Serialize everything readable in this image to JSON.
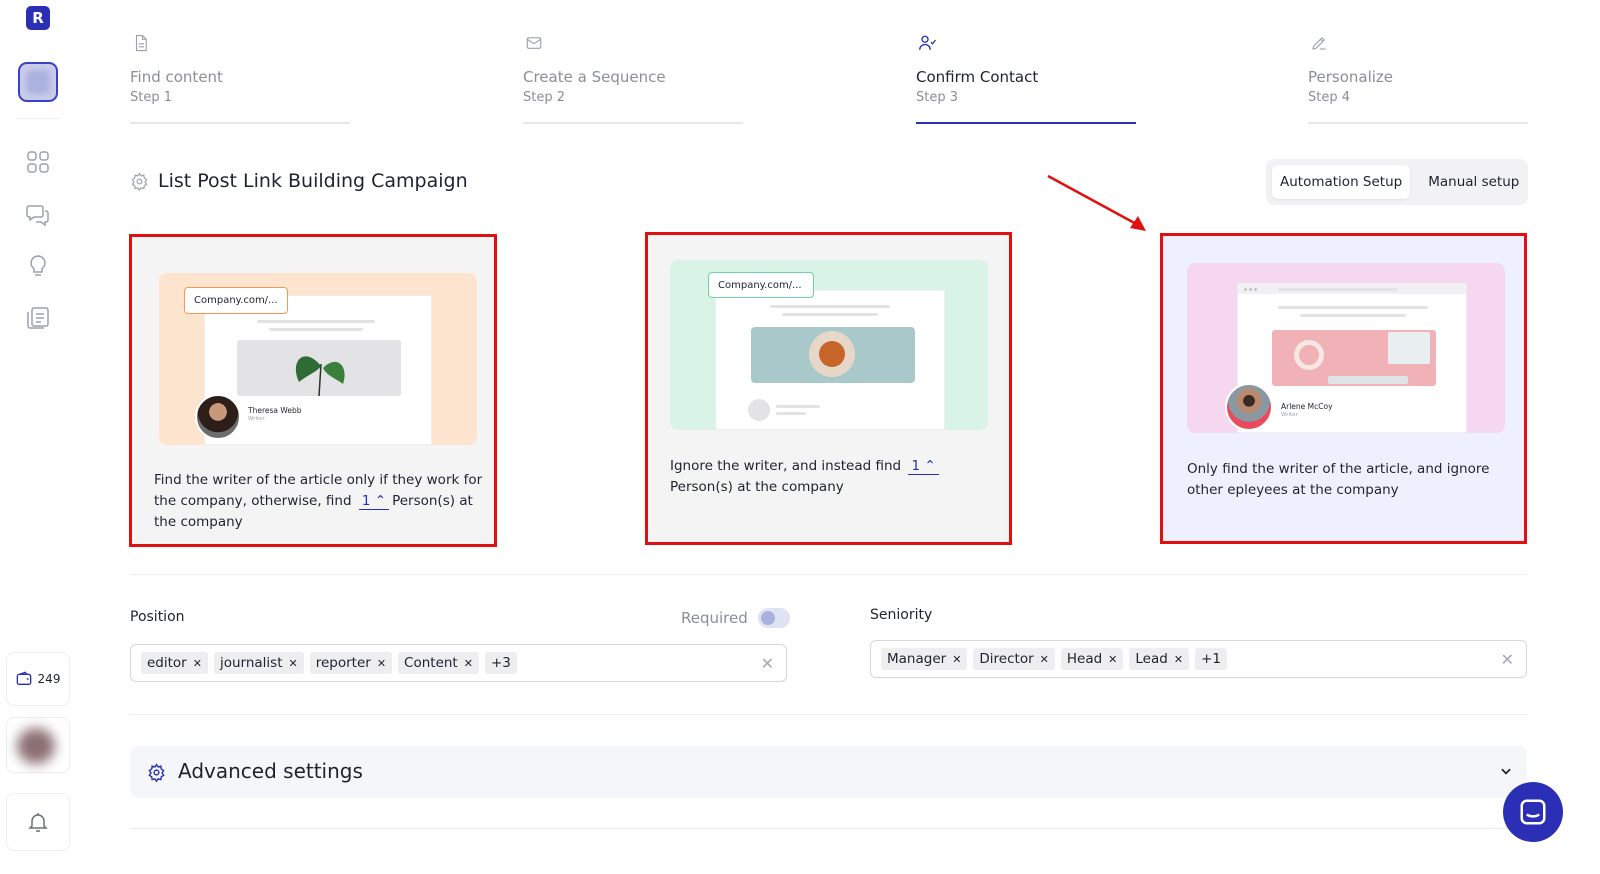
{
  "app": {
    "logo_letter": "R"
  },
  "sidebar": {
    "icons": [
      "grid-icon",
      "chat-bubbles-icon",
      "lightbulb-icon",
      "documents-icon"
    ],
    "credits": "249",
    "credits_icon": "wallet-icon",
    "notifications_icon": "bell-icon"
  },
  "steps": [
    {
      "title": "Find content",
      "sub": "Step 1",
      "icon": "document-icon",
      "active": false
    },
    {
      "title": "Create a Sequence",
      "sub": "Step 2",
      "icon": "mail-icon",
      "active": false
    },
    {
      "title": "Confirm Contact",
      "sub": "Step 3",
      "icon": "user-check-icon",
      "active": true
    },
    {
      "title": "Personalize",
      "sub": "Step 4",
      "icon": "pen-icon",
      "active": false
    }
  ],
  "campaign": {
    "title": "List Post Link Building Campaign"
  },
  "setup_toggle": {
    "automation": "Automation Setup",
    "manual": "Manual setup",
    "selected": "Automation Setup"
  },
  "options": [
    {
      "url": "Company.com/...",
      "person_name": "Theresa Webb",
      "person_role": "Writer",
      "text_before": "Find the writer of the article only if they work for the company, otherwise, find",
      "count": "1",
      "text_after": "Person(s) at the company"
    },
    {
      "url": "Company.com/...",
      "text_before": "Ignore the writer, and instead find",
      "count": "1",
      "text_after": "Person(s) at the company"
    },
    {
      "person_name": "Arlene McCoy",
      "person_role": "Writer",
      "text": "Only find the writer of the article, and ignore other epleyees at the company",
      "selected": true
    }
  ],
  "position": {
    "label": "Position",
    "required_label": "Required",
    "required": false,
    "tags": [
      "editor",
      "journalist",
      "reporter",
      "Content"
    ],
    "more": "+3"
  },
  "seniority": {
    "label": "Seniority",
    "tags": [
      "Manager",
      "Director",
      "Head",
      "Lead"
    ],
    "more": "+1"
  },
  "advanced": {
    "title": "Advanced settings"
  },
  "colors": {
    "accent": "#2b2fb5",
    "highlight": "#e01010",
    "selected_bg": "#eef0fd"
  }
}
